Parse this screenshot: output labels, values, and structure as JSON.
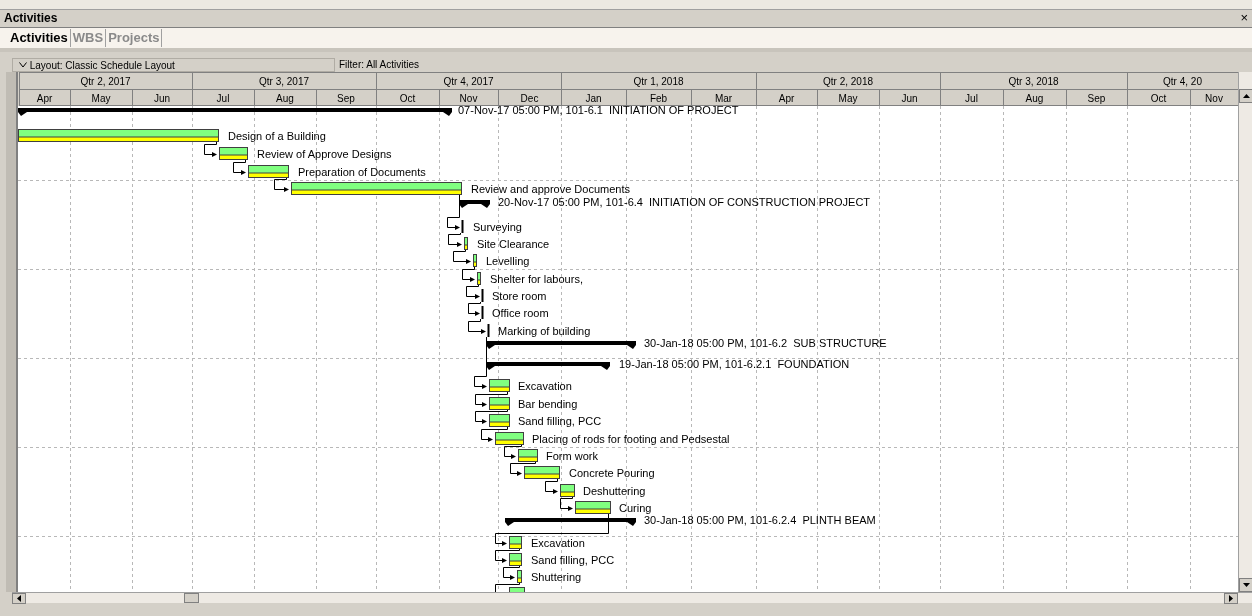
{
  "window": {
    "title": "Activities",
    "close": "×"
  },
  "tabs": [
    {
      "label": "Activities",
      "selected": true
    },
    {
      "label": "WBS",
      "selected": false
    },
    {
      "label": "Projects",
      "selected": false
    }
  ],
  "layout_bar": {
    "layout": "Layout: Classic Schedule Layout",
    "filter": "Filter: All Activities"
  },
  "timescale": {
    "quarters": [
      "Qtr 2, 2017",
      "Qtr 3, 2017",
      "Qtr 4, 2017",
      "Qtr 1, 2018",
      "Qtr 2, 2018",
      "Qtr 3, 2018",
      "Qtr 4, 20"
    ],
    "months": [
      "Apr",
      "May",
      "Jun",
      "Jul",
      "Aug",
      "Sep",
      "Oct",
      "Nov",
      "Dec",
      "Jan",
      "Feb",
      "Mar",
      "Apr",
      "May",
      "Jun",
      "Jul",
      "Aug",
      "Sep",
      "Oct",
      "Nov"
    ]
  },
  "rows": [
    {
      "kind": "summary",
      "label": "07-Nov-17 05:00 PM, 101-6.1  INITIATION OF PROJECT"
    },
    {
      "kind": "activity",
      "label": "Design of a Building"
    },
    {
      "kind": "activity",
      "label": "Review of Approve Designs"
    },
    {
      "kind": "activity",
      "label": "Preparation of Documents"
    },
    {
      "kind": "activity",
      "label": "Review and approve Documents"
    },
    {
      "kind": "summary",
      "label": "20-Nov-17 05:00 PM, 101-6.4  INITIATION OF CONSTRUCTION PROJECT"
    },
    {
      "kind": "activity",
      "label": "Surveying"
    },
    {
      "kind": "activity",
      "label": "Site Clearance"
    },
    {
      "kind": "activity",
      "label": "Levelling"
    },
    {
      "kind": "activity",
      "label": "Shelter for labours,"
    },
    {
      "kind": "activity",
      "label": "Store room"
    },
    {
      "kind": "activity",
      "label": "Office room"
    },
    {
      "kind": "activity",
      "label": "Marking of building"
    },
    {
      "kind": "summary",
      "label": "30-Jan-18 05:00 PM, 101-6.2  SUB STRUCTURE"
    },
    {
      "kind": "summary",
      "label": "19-Jan-18 05:00 PM, 101-6.2.1  FOUNDATION"
    },
    {
      "kind": "activity",
      "label": "Excavation"
    },
    {
      "kind": "activity",
      "label": "Bar bending"
    },
    {
      "kind": "activity",
      "label": "Sand filling, PCC"
    },
    {
      "kind": "activity",
      "label": "Placing of rods for footing and Pedsestal"
    },
    {
      "kind": "activity",
      "label": "Form work"
    },
    {
      "kind": "activity",
      "label": "Concrete Pouring"
    },
    {
      "kind": "activity",
      "label": "Deshuttering"
    },
    {
      "kind": "activity",
      "label": "Curing"
    },
    {
      "kind": "summary",
      "label": "30-Jan-18 05:00 PM, 101-6.2.4  PLINTH BEAM"
    },
    {
      "kind": "activity",
      "label": "Excavation"
    },
    {
      "kind": "activity",
      "label": "Sand filling, PCC"
    },
    {
      "kind": "activity",
      "label": "Shuttering"
    },
    {
      "kind": "activity"
    }
  ]
}
